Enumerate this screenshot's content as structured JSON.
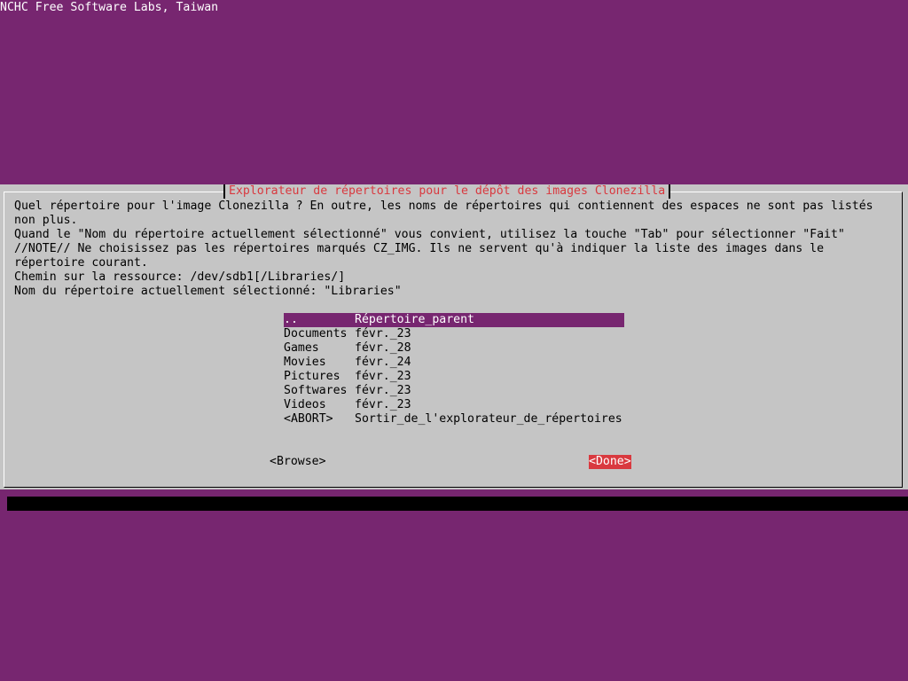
{
  "backtitle": "NCHC Free Software Labs, Taiwan",
  "dialog": {
    "title": "Explorateur de répertoires pour le dépôt des images Clonezilla",
    "prompt_lines": [
      "Quel répertoire pour l'image Clonezilla ? En outre, les noms de répertoires qui contiennent des espaces ne sont pas listés",
      "non plus.",
      "Quand le \"Nom du répertoire actuellement sélectionné\" vous convient, utilisez la touche \"Tab\" pour sélectionner \"Fait\"",
      "//NOTE// Ne choisissez pas les répertoires marqués CZ_IMG. Ils ne servent qu'à indiquer la liste des images dans le",
      "répertoire courant.",
      "Chemin sur la ressource: /dev/sdb1[/Libraries/]",
      "Nom du répertoire actuellement sélectionné: \"Libraries\""
    ],
    "menu": [
      {
        "tag": "..",
        "item": "Répertoire_parent",
        "selected": true
      },
      {
        "tag": "Documents",
        "item": "févr._23",
        "selected": false
      },
      {
        "tag": "Games",
        "item": "févr._28",
        "selected": false
      },
      {
        "tag": "Movies",
        "item": "févr._24",
        "selected": false
      },
      {
        "tag": "Pictures",
        "item": "févr._23",
        "selected": false
      },
      {
        "tag": "Softwares",
        "item": "févr._23",
        "selected": false
      },
      {
        "tag": "Videos",
        "item": "févr._23",
        "selected": false
      },
      {
        "tag": "<ABORT>",
        "item": "Sortir_de_l'explorateur_de_répertoires",
        "selected": false
      }
    ],
    "buttons": {
      "browse": "<Browse>",
      "done": "<Done>"
    }
  },
  "colors": {
    "background": "#772670",
    "dialog": "#c5c5c5",
    "title": "#d9393f",
    "selection": "#772670",
    "active_button": "#d9393f"
  }
}
